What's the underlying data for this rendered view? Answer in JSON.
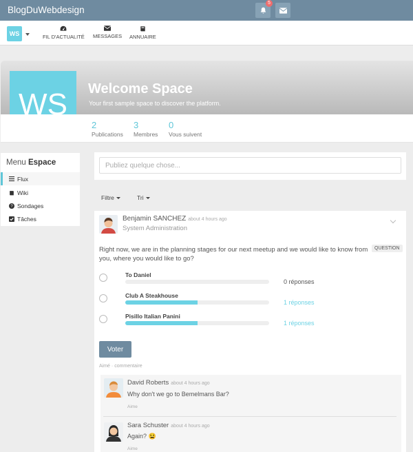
{
  "topbar": {
    "brand": "BlogDuWebdesign",
    "notifications_count": "5",
    "bell_icon": "bell-icon",
    "mail_icon": "envelope-icon"
  },
  "navbar": {
    "space_initials": "WS",
    "items": [
      {
        "label": "FIL D'ACTUALITÉ",
        "icon": "dashboard-icon"
      },
      {
        "label": "MESSAGES",
        "icon": "envelope-icon"
      },
      {
        "label": "ANNUAIRE",
        "icon": "book-icon"
      }
    ]
  },
  "space": {
    "initials": "WS",
    "title": "Welcome Space",
    "subtitle": "Your first sample space to discover the platform.",
    "stats": [
      {
        "value": "2",
        "label": "Publications"
      },
      {
        "value": "3",
        "label": "Membres"
      },
      {
        "value": "0",
        "label": "Vous suivent"
      }
    ]
  },
  "menu": {
    "title_prefix": "Menu",
    "title_bold": "Espace",
    "items": [
      {
        "label": "Flux",
        "icon": "list-icon"
      },
      {
        "label": "Wiki",
        "icon": "book-icon"
      },
      {
        "label": "Sondages",
        "icon": "question-circle-icon"
      },
      {
        "label": "Tâches",
        "icon": "check-square-icon"
      }
    ]
  },
  "composer": {
    "placeholder": "Publiez quelque chose..."
  },
  "filters": {
    "filter_label": "Filtre",
    "sort_label": "Tri"
  },
  "post": {
    "author": "Benjamin SANCHEZ",
    "time": "about 4 hours ago",
    "role": "System Administration",
    "question": "Right now, we are in the planning stages for our next meetup and we would like to know from you, where you would like to go?",
    "badge": "QUESTION",
    "options": [
      {
        "label": "To Daniel",
        "fraction": 0,
        "votes": "0 réponses"
      },
      {
        "label": "Club A Steakhouse",
        "fraction": 0.5,
        "votes": "1 réponses"
      },
      {
        "label": "Pisillo Italian Panini",
        "fraction": 0.5,
        "votes": "1 réponses"
      }
    ],
    "vote_button": "Voter",
    "like": "Aimé",
    "separator": "·",
    "comment": "commentaire"
  },
  "comments": [
    {
      "author": "David Roberts",
      "time": "about 4 hours ago",
      "text": "Why don't we go to Bemelmans Bar?",
      "like": "Aime"
    },
    {
      "author": "Sara Schuster",
      "time": "about 4 hours ago",
      "text": "Again? 😫",
      "like": "Aime"
    }
  ]
}
